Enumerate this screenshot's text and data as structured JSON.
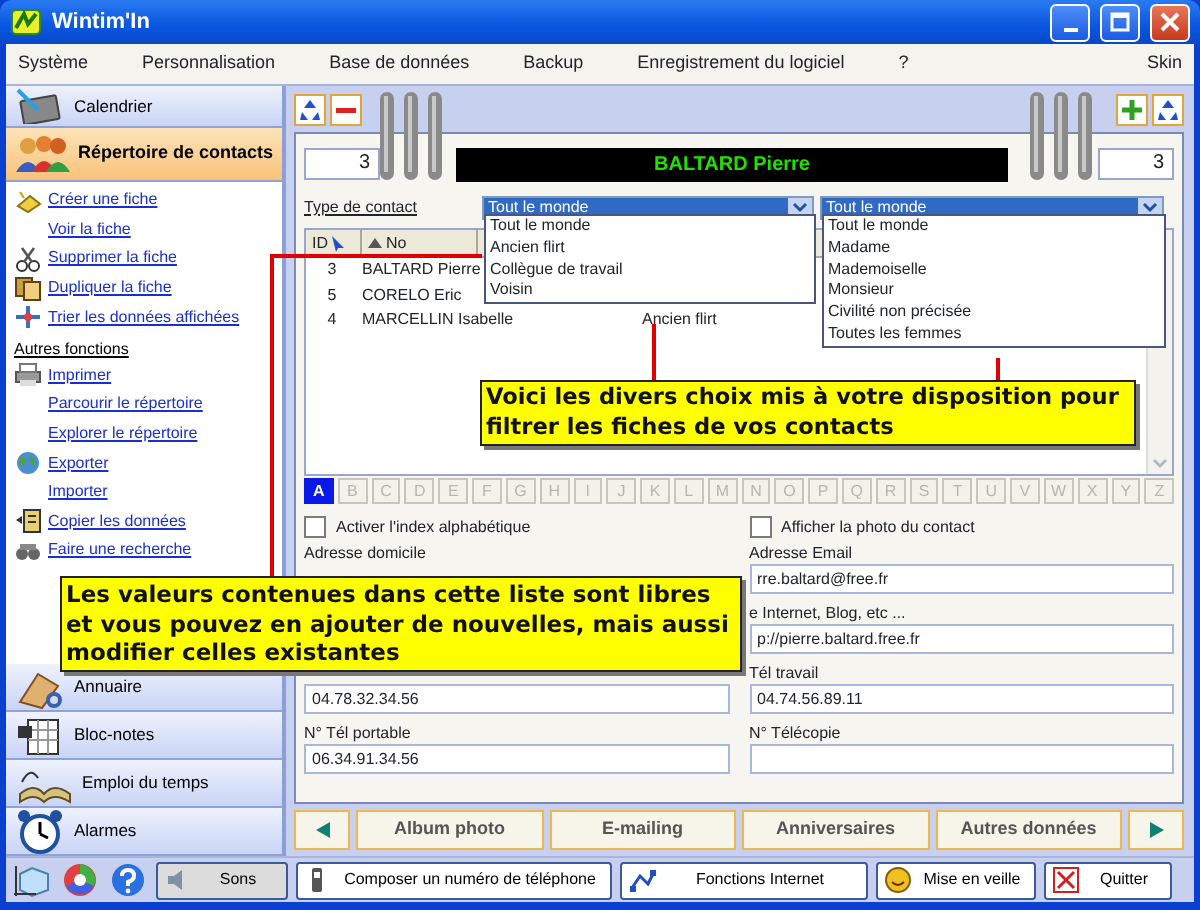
{
  "window": {
    "title": "Wintim'In"
  },
  "menu": {
    "items": [
      "Système",
      "Personnalisation",
      "Base de données",
      "Backup",
      "Enregistrement du logiciel",
      "?"
    ],
    "skin": "Skin"
  },
  "sidebar": {
    "top": [
      {
        "label": "Calendrier",
        "selected": false
      },
      {
        "label": "Répertoire de contacts",
        "selected": true
      }
    ],
    "links": [
      {
        "kind": "link",
        "label": "Créer une fiche",
        "icon": true
      },
      {
        "kind": "link",
        "label": "Voir la fiche",
        "icon": false
      },
      {
        "kind": "link",
        "label": "Supprimer la fiche",
        "icon": true
      },
      {
        "kind": "link",
        "label": "Dupliquer la fiche",
        "icon": true
      },
      {
        "kind": "link",
        "label": "Trier les données affichées",
        "icon": true
      },
      {
        "kind": "heading",
        "label": "Autres fonctions"
      },
      {
        "kind": "link",
        "label": "Imprimer",
        "icon": true
      },
      {
        "kind": "link",
        "label": "Parcourir le répertoire",
        "icon": false
      },
      {
        "kind": "link",
        "label": "Explorer le répertoire",
        "icon": false
      },
      {
        "kind": "link",
        "label": "Exporter",
        "icon": true
      },
      {
        "kind": "link",
        "label": "Importer",
        "icon": false
      },
      {
        "kind": "link",
        "label": "Copier les données",
        "icon": true
      },
      {
        "kind": "link",
        "label": "Faire une recherche",
        "icon": true
      }
    ],
    "bottom": [
      {
        "label": "Annuaire"
      },
      {
        "label": "Bloc-notes"
      },
      {
        "label": "Emploi du temps"
      },
      {
        "label": "Alarmes"
      }
    ]
  },
  "record": {
    "number": "3",
    "name": "BALTARD Pierre",
    "count": "3"
  },
  "filter": {
    "label": "Type de contact",
    "dropdowns": [
      {
        "value": "Tout le monde",
        "options": [
          "Tout le monde",
          "Ancien flirt",
          "Collègue de travail",
          "Voisin"
        ]
      },
      {
        "value": "Tout le monde",
        "options": [
          "Tout le monde",
          "Madame",
          "Mademoiselle",
          "Monsieur",
          "Civilité non précisée",
          "Toutes les femmes"
        ]
      }
    ]
  },
  "table": {
    "columns": [
      "ID",
      "No"
    ],
    "rows": [
      {
        "id": "3",
        "name": "BALTARD Pierre"
      },
      {
        "id": "5",
        "name": "CORELO Eric"
      },
      {
        "id": "4",
        "name": "MARCELLIN Isabelle",
        "type": "Ancien flirt"
      }
    ]
  },
  "alphabet": [
    {
      "letter": "A",
      "selected": true
    },
    {
      "letter": "B",
      "selected": false
    },
    {
      "letter": "C",
      "selected": false
    },
    {
      "letter": "D",
      "selected": false
    },
    {
      "letter": "E",
      "selected": false
    },
    {
      "letter": "F",
      "selected": false
    },
    {
      "letter": "G",
      "selected": false
    },
    {
      "letter": "H",
      "selected": false
    },
    {
      "letter": "I",
      "selected": false
    },
    {
      "letter": "J",
      "selected": false
    },
    {
      "letter": "K",
      "selected": false
    },
    {
      "letter": "L",
      "selected": false
    },
    {
      "letter": "M",
      "selected": false
    },
    {
      "letter": "N",
      "selected": false
    },
    {
      "letter": "O",
      "selected": false
    },
    {
      "letter": "P",
      "selected": false
    },
    {
      "letter": "Q",
      "selected": false
    },
    {
      "letter": "R",
      "selected": false
    },
    {
      "letter": "S",
      "selected": false
    },
    {
      "letter": "T",
      "selected": false
    },
    {
      "letter": "U",
      "selected": false
    },
    {
      "letter": "V",
      "selected": false
    },
    {
      "letter": "W",
      "selected": false
    },
    {
      "letter": "X",
      "selected": false
    },
    {
      "letter": "Y",
      "selected": false
    },
    {
      "letter": "Z",
      "selected": false
    }
  ],
  "checkboxes": [
    {
      "label": "Activer l'index alphabétique",
      "checked": false
    },
    {
      "label": "Afficher la photo du contact",
      "checked": false
    }
  ],
  "fields": {
    "left": [
      {
        "kind": "covered",
        "label": "Adresse domicile"
      },
      {
        "kind": "text",
        "value": "04.78.32.34.56"
      },
      {
        "kind": "text",
        "label": "N° Tél portable",
        "value": "06.34.91.34.56"
      }
    ],
    "right": [
      {
        "kind": "text",
        "label": "Adresse Email",
        "value": "rre.baltard@free.fr"
      },
      {
        "kind": "text",
        "label": "e Internet, Blog, etc ...",
        "value": "p://pierre.baltard.free.fr"
      },
      {
        "kind": "text",
        "label": "Tél travail",
        "value": "04.74.56.89.11"
      },
      {
        "kind": "text",
        "label": "N° Télécopie"
      }
    ]
  },
  "nav_tabs": [
    "Album photo",
    "E-mailing",
    "Anniversaires",
    "Autres données"
  ],
  "status_bar": [
    {
      "label": "Sons",
      "pressed": true
    },
    {
      "label": "Composer un numéro de téléphone",
      "pressed": false
    },
    {
      "label": "Fonctions Internet",
      "pressed": false
    },
    {
      "label": "Mise en veille",
      "pressed": false
    },
    {
      "label": "Quitter",
      "pressed": false
    }
  ],
  "callouts": [
    {
      "text": "Voici les divers choix mis à votre disposition pour filtrer les fiches de vos contacts"
    },
    {
      "text": "Les valeurs contenues dans cette liste sont libres et vous pouvez en ajouter de nouvelles, mais aussi modifier celles existantes"
    }
  ]
}
